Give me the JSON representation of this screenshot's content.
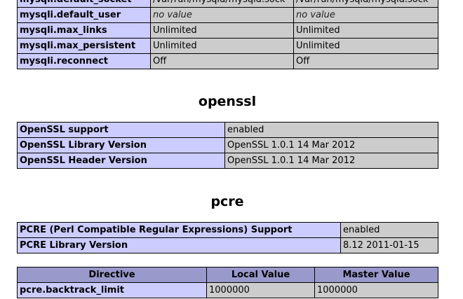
{
  "mysqli": {
    "rows": [
      {
        "directive": "mysqli.default_socket",
        "local": "/var/run/mysqld/mysqld.sock",
        "master": "/var/run/mysqld/mysqld.sock"
      },
      {
        "directive": "mysqli.default_user",
        "local": "no value",
        "master": "no value"
      },
      {
        "directive": "mysqli.max_links",
        "local": "Unlimited",
        "master": "Unlimited"
      },
      {
        "directive": "mysqli.max_persistent",
        "local": "Unlimited",
        "master": "Unlimited"
      },
      {
        "directive": "mysqli.reconnect",
        "local": "Off",
        "master": "Off"
      }
    ]
  },
  "openssl": {
    "title": "openssl",
    "rows": [
      {
        "label": "OpenSSL support",
        "value": "enabled"
      },
      {
        "label": "OpenSSL Library Version",
        "value": "OpenSSL 1.0.1 14 Mar 2012"
      },
      {
        "label": "OpenSSL Header Version",
        "value": "OpenSSL 1.0.1 14 Mar 2012"
      }
    ]
  },
  "pcre": {
    "title": "pcre",
    "rows": [
      {
        "label": "PCRE (Perl Compatible Regular Expressions) Support",
        "value": "enabled"
      },
      {
        "label": "PCRE Library Version",
        "value": "8.12 2011-01-15"
      }
    ],
    "directives_header": {
      "directive": "Directive",
      "local": "Local Value",
      "master": "Master Value"
    },
    "directives": [
      {
        "directive": "pcre.backtrack_limit",
        "local": "1000000",
        "master": "1000000"
      }
    ]
  },
  "colors": {
    "label_bg": "#ccccff",
    "value_bg": "#cccccc",
    "header_bg": "#9999cc"
  }
}
